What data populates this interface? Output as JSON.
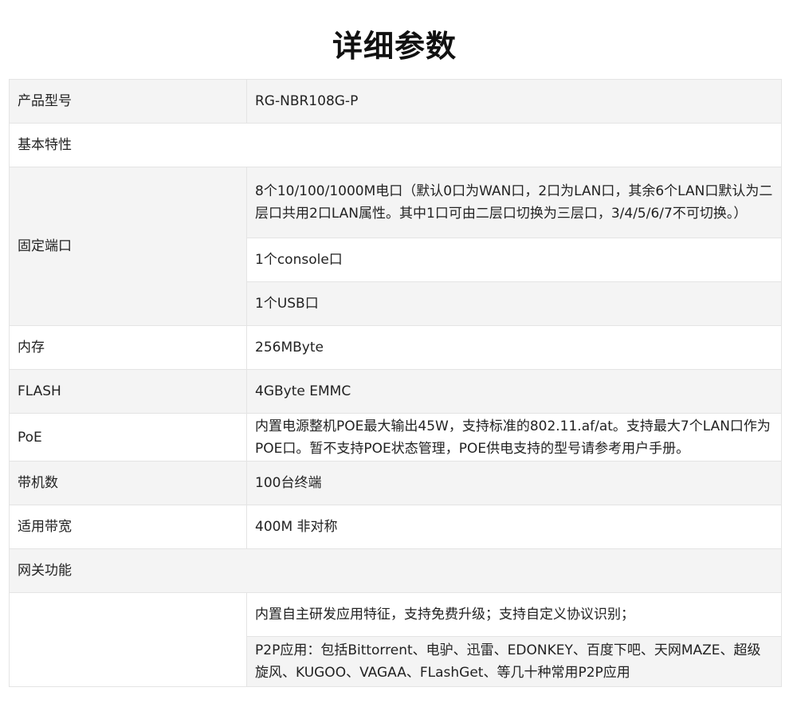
{
  "title": "详细参数",
  "rows": {
    "model": {
      "label": "产品型号",
      "value": "RG-NBR108G-P"
    },
    "features": {
      "label": "基本特性"
    },
    "ports": {
      "label": "固定端口",
      "values": [
        "8个10/100/1000M电口（默认0口为WAN口，2口为LAN口，其余6个LAN口默认为二层口共用2口LAN属性。其中1口可由二层口切换为三层口，3/4/5/6/7不可切换。）",
        "1个console口",
        "1个USB口"
      ]
    },
    "memory": {
      "label": "内存",
      "value": "256MByte"
    },
    "flash": {
      "label": "FLASH",
      "value": "4GByte EMMC"
    },
    "poe": {
      "label": "PoE",
      "value": "内置电源整机POE最大输出45W，支持标准的802.11.af/at。支持最大7个LAN口作为POE口。暂不支持POE状态管理，POE供电支持的型号请参考用户手册。"
    },
    "clients": {
      "label": "带机数",
      "value": "100台终端"
    },
    "bandwidth": {
      "label": "适用带宽",
      "value": "400M 非对称"
    },
    "gateway": {
      "label": "网关功能"
    },
    "app": {
      "label": "",
      "values": [
        "内置自主研发应用特征，支持免费升级；支持自定义协议识别；",
        "P2P应用：包括Bittorrent、电驴、迅雷、EDONKEY、百度下吧、天网MAZE、超级旋风、KUGOO、VAGAA、FLashGet、等几十种常用P2P应用"
      ]
    }
  }
}
